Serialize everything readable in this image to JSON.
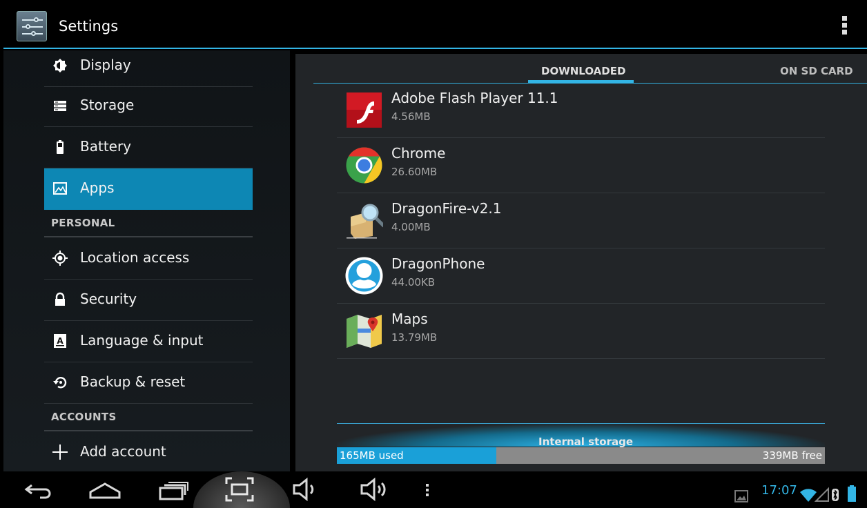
{
  "action_bar": {
    "title": "Settings",
    "icon": "settings-sliders-icon",
    "overflow_icon": "overflow-menu-icon"
  },
  "sidebar": {
    "items": [
      {
        "label": "Display",
        "icon": "brightness-icon"
      },
      {
        "label": "Storage",
        "icon": "storage-icon"
      },
      {
        "label": "Battery",
        "icon": "battery-icon"
      },
      {
        "label": "Apps",
        "icon": "apps-icon",
        "selected": true
      }
    ],
    "personal_header": "PERSONAL",
    "personal_items": [
      {
        "label": "Location access",
        "icon": "location-icon"
      },
      {
        "label": "Security",
        "icon": "lock-icon"
      },
      {
        "label": "Language & input",
        "icon": "keyboard-icon"
      },
      {
        "label": "Backup & reset",
        "icon": "backup-icon"
      }
    ],
    "accounts_header": "ACCOUNTS",
    "accounts_items": [
      {
        "label": "Add account",
        "icon": "plus-icon"
      }
    ]
  },
  "tabs": {
    "downloaded": "DOWNLOADED",
    "sd_card": "ON SD CARD"
  },
  "apps": [
    {
      "name": "Adobe Flash Player 11.1",
      "size": "4.56MB",
      "icon": "flash-icon"
    },
    {
      "name": "Chrome",
      "size": "26.60MB",
      "icon": "chrome-icon"
    },
    {
      "name": "DragonFire-v2.1",
      "size": "4.00MB",
      "icon": "package-magnifier-icon"
    },
    {
      "name": "DragonPhone",
      "size": "44.00KB",
      "icon": "dragonphone-icon"
    },
    {
      "name": "Maps",
      "size": "13.79MB",
      "icon": "maps-icon"
    }
  ],
  "storage": {
    "label": "Internal storage",
    "used": "165MB used",
    "free": "339MB free",
    "used_fraction": 0.327
  },
  "status": {
    "time": "17:07"
  },
  "colors": {
    "accent": "#33b5e5",
    "selected": "#0d87b4"
  }
}
